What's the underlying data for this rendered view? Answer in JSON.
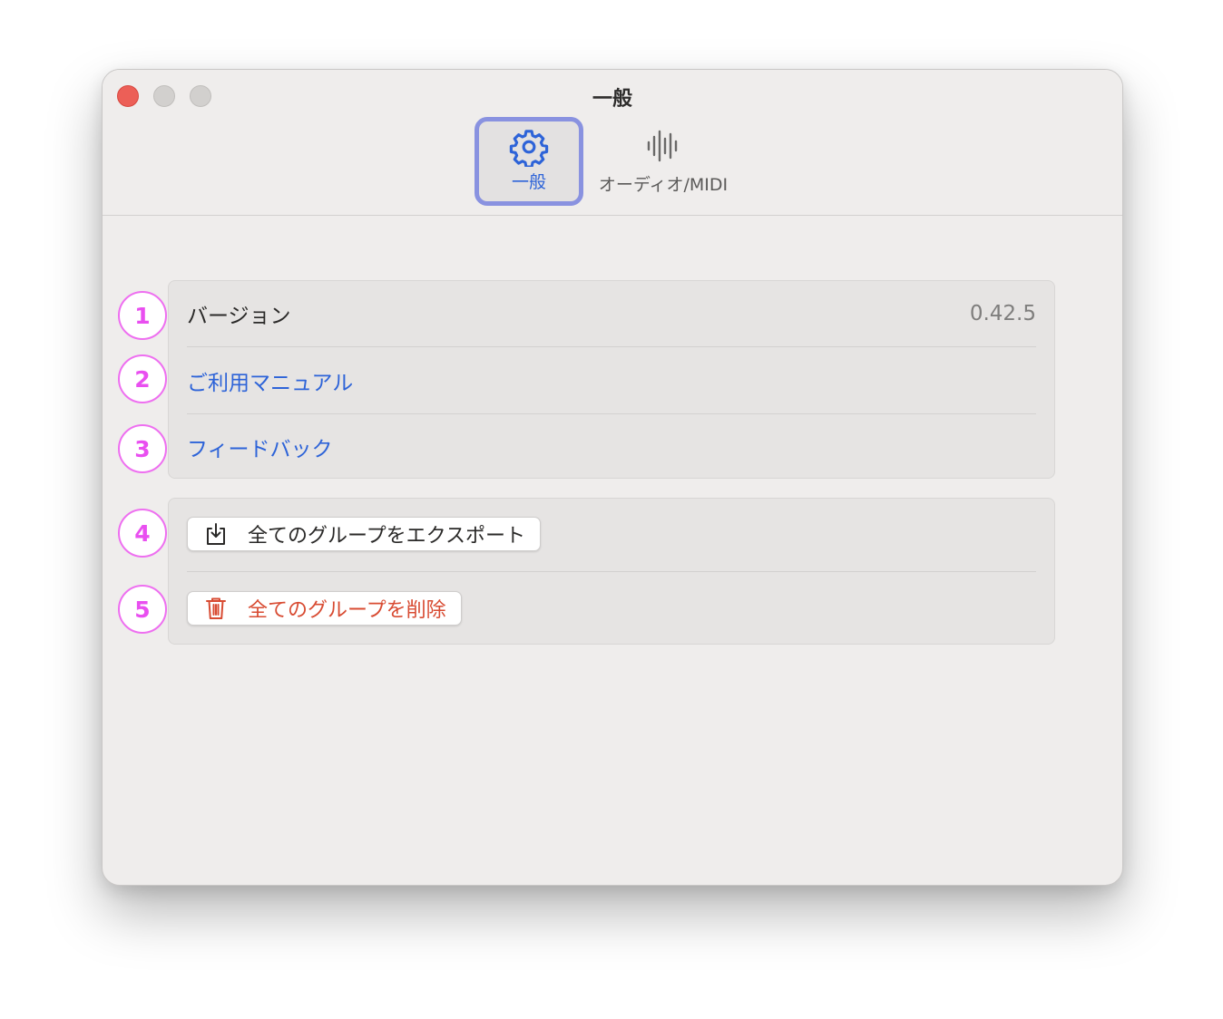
{
  "window": {
    "title": "一般"
  },
  "toolbar": {
    "tabs": [
      {
        "label": "一般",
        "icon": "gear-icon",
        "selected": true
      },
      {
        "label": "オーディオ/MIDI",
        "icon": "waveform-icon",
        "selected": false
      }
    ]
  },
  "general": {
    "info_rows": [
      {
        "label": "バージョン",
        "value": "0.42.5"
      },
      {
        "label": "ご利用マニュアル",
        "link": true
      },
      {
        "label": "フィードバック",
        "link": true
      }
    ],
    "actions": [
      {
        "label": "全てのグループをエクスポート",
        "icon": "export-tray-icon"
      },
      {
        "label": "全てのグループを削除",
        "icon": "trash-icon",
        "destructive": true
      }
    ]
  },
  "markers": [
    "1",
    "2",
    "3",
    "4",
    "5"
  ],
  "colors": {
    "accent_blue": "#2d63d8",
    "selection_border": "#8992e0",
    "destructive_red": "#d84b32",
    "marker_pink": "#e94ff0",
    "close_red": "#ec5f57"
  }
}
